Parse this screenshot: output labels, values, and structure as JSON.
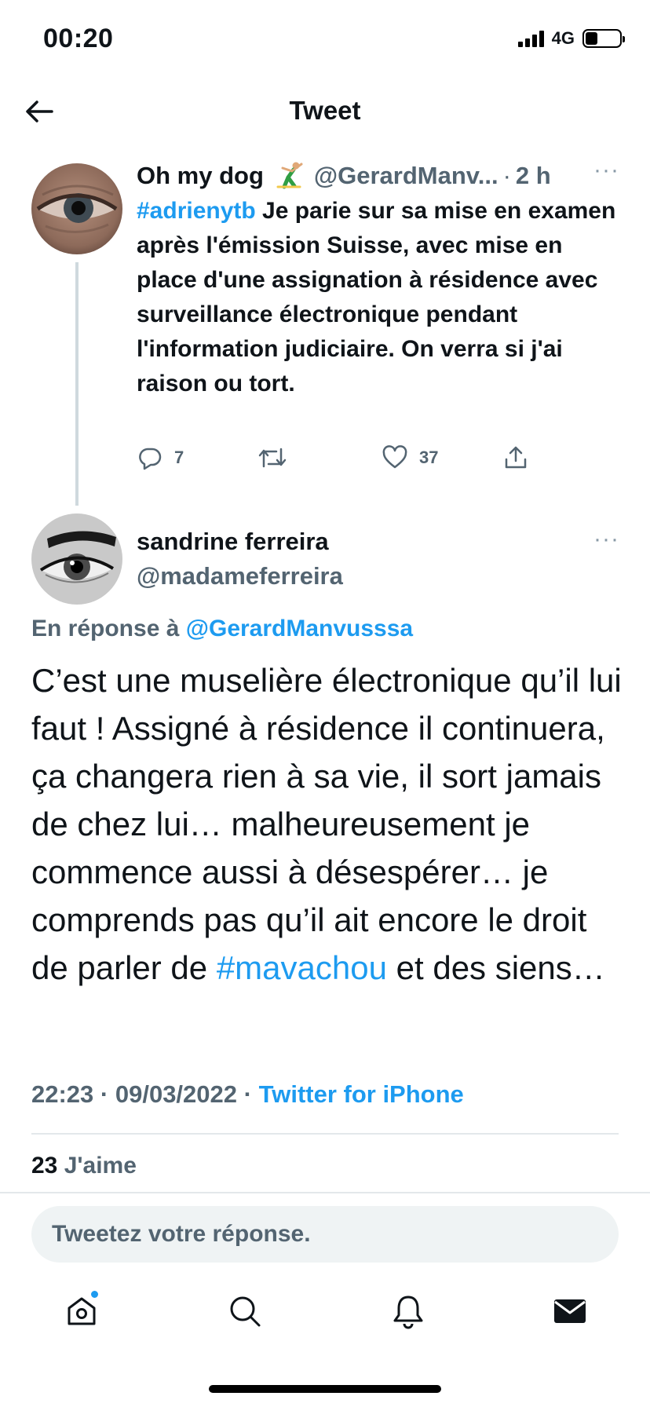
{
  "status_bar": {
    "time": "00:20",
    "network": "4G",
    "battery_level": 0.35,
    "signal_bars": 4
  },
  "header": {
    "title": "Tweet",
    "back_icon": "arrow-left-icon"
  },
  "parent_tweet": {
    "display_name": "Oh my dog",
    "name_emoji": "gymnast-emoji",
    "handle": "@GerardManv...",
    "separator": "·",
    "time": "2 h",
    "more": "···",
    "hashtag": "#adrienytb",
    "text": " Je parie sur sa mise en examen après l'émission Suisse, avec mise en place d'une assignation à résidence avec surveillance électronique pendant l'information judiciaire. On verra si j'ai raison ou tort.",
    "replies": "7",
    "retweets": "",
    "likes": "37"
  },
  "reply_tweet": {
    "display_name": "sandrine ferreira",
    "handle": "@madameferreira",
    "more": "···",
    "reply_prefix": "En réponse à ",
    "reply_mention": "@GerardManvusssa",
    "text_before": "C’est une muselière électronique qu’il lui faut ! Assigné à résidence il continuera, ça changera rien à sa vie, il sort jamais de chez lui… malheureusement je commence aussi à désespérer… je comprends pas qu’il ait encore le droit de parler de ",
    "hashtag": "#mavachou",
    "text_after": " et des siens…",
    "time": "22:23",
    "date": "09/03/2022",
    "separator": " · ",
    "source": "Twitter for iPhone",
    "like_count": "23",
    "like_label": " J'aime"
  },
  "compose": {
    "placeholder": "Tweetez votre réponse."
  },
  "tabbar": {
    "tabs": [
      {
        "name": "home",
        "icon": "home-icon",
        "has_notification": true
      },
      {
        "name": "search",
        "icon": "search-icon",
        "has_notification": false
      },
      {
        "name": "notifications",
        "icon": "bell-icon",
        "has_notification": false
      },
      {
        "name": "messages",
        "icon": "envelope-icon",
        "has_notification": false
      }
    ]
  },
  "colors": {
    "accent": "#1d9bf0",
    "secondary_text": "#536471",
    "primary_text": "#0f1419",
    "divider": "#e3e8eb"
  }
}
